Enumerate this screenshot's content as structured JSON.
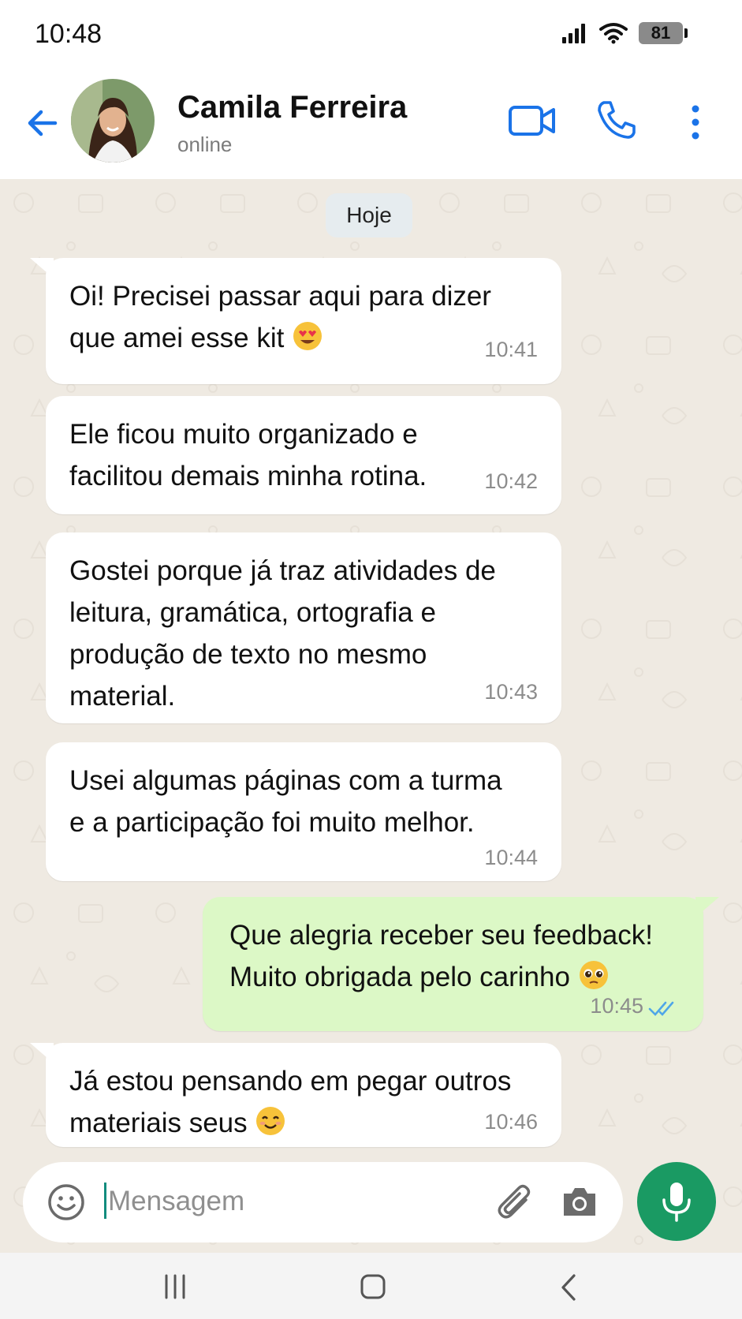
{
  "status_bar": {
    "time": "10:48",
    "battery": "81"
  },
  "header": {
    "contact_name": "Camila Ferreira",
    "contact_status": "online",
    "icons": [
      "back-arrow-icon",
      "video-call-icon",
      "phone-icon",
      "more-vertical-icon"
    ],
    "accent_color": "#1a73e8"
  },
  "chat": {
    "date_chip": "Hoje",
    "messages": [
      {
        "direction": "incoming",
        "text": "Oi! Precisei passar aqui para dizer\nque amei esse kit",
        "emoji": "heart-eyes",
        "time": "10:41"
      },
      {
        "direction": "incoming",
        "text": "Ele ficou muito organizado e\nfacilitou demais minha rotina.",
        "time": "10:42"
      },
      {
        "direction": "incoming",
        "text": "Gostei porque já traz atividades de\nleitura, gramática, ortografia e\nprodução de texto no mesmo\nmaterial.",
        "time": "10:43"
      },
      {
        "direction": "incoming",
        "text": "Usei algumas páginas com a turma\ne a participação foi muito melhor.",
        "time": "10:44"
      },
      {
        "direction": "outgoing",
        "text": "Que alegria receber seu feedback!\nMuito obrigada pelo carinho",
        "emoji": "pleading",
        "time": "10:45",
        "read_receipt": "double-check-icon"
      },
      {
        "direction": "incoming",
        "text": "Já estou pensando em pegar outros\nmateriais seus",
        "emoji": "smiling",
        "time": "10:46"
      }
    ],
    "colors": {
      "background": "#efeae2",
      "incoming_bubble": "#ffffff",
      "outgoing_bubble": "#dcf8c6"
    }
  },
  "composer": {
    "placeholder": "Mensagem",
    "value": "",
    "icons": [
      "emoji-icon",
      "paperclip-icon",
      "camera-icon",
      "microphone-icon"
    ],
    "mic_color": "#1a9a63"
  },
  "navbar": {
    "icons": [
      "recents-icon",
      "home-icon",
      "back-icon"
    ]
  }
}
